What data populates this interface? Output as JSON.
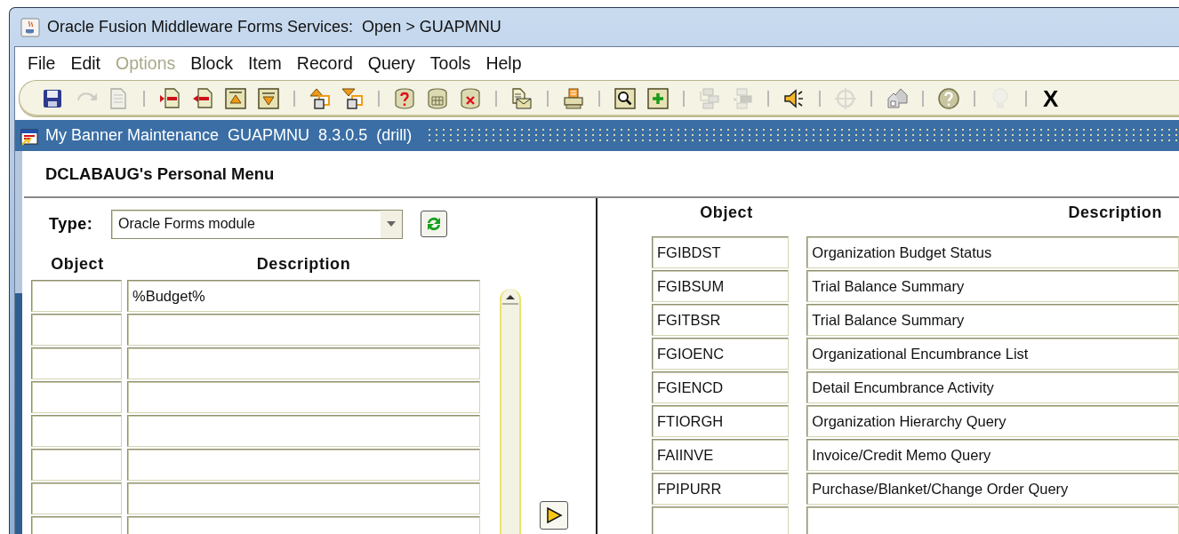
{
  "window": {
    "title": "Oracle Fusion Middleware Forms Services:  Open > GUAPMNU"
  },
  "menu": [
    {
      "label": "File",
      "disabled": false
    },
    {
      "label": "Edit",
      "disabled": false
    },
    {
      "label": "Options",
      "disabled": true
    },
    {
      "label": "Block",
      "disabled": false
    },
    {
      "label": "Item",
      "disabled": false
    },
    {
      "label": "Record",
      "disabled": false
    },
    {
      "label": "Query",
      "disabled": false
    },
    {
      "label": "Tools",
      "disabled": false
    },
    {
      "label": "Help",
      "disabled": false
    }
  ],
  "toolbar": {
    "groups": [
      [
        {
          "disabled": false
        },
        {
          "disabled": true
        },
        {
          "disabled": true
        }
      ],
      [
        {
          "disabled": false
        },
        {
          "disabled": false
        },
        {
          "disabled": false
        },
        {
          "disabled": false
        }
      ],
      [
        {
          "disabled": false
        },
        {
          "disabled": false
        }
      ],
      [
        {
          "disabled": false
        },
        {
          "disabled": false
        },
        {
          "disabled": false
        }
      ],
      [
        {
          "disabled": false
        }
      ],
      [
        {
          "disabled": false
        }
      ],
      [
        {
          "disabled": false
        },
        {
          "disabled": false
        }
      ],
      [
        {
          "disabled": true
        },
        {
          "disabled": true
        }
      ],
      [
        {
          "disabled": false
        }
      ],
      [
        {
          "disabled": true
        }
      ],
      [
        {
          "disabled": false
        }
      ],
      [
        {
          "disabled": false
        }
      ],
      [
        {
          "disabled": true
        }
      ]
    ],
    "exit_label": "X"
  },
  "form_bar": {
    "title": "My Banner Maintenance  GUAPMNU  8.3.0.5  (drill)"
  },
  "heading": "DCLABAUG's Personal Menu",
  "search": {
    "type_label": "Type:",
    "type_value": "Oracle Forms module",
    "columns": [
      "Object",
      "Description"
    ],
    "rows": [
      {
        "description": "%Budget%"
      }
    ]
  },
  "results": {
    "columns": [
      "Object",
      "Description"
    ],
    "rows": [
      {
        "object": "FGIBDST",
        "description": "Organization Budget Status"
      },
      {
        "object": "FGIBSUM",
        "description": "Trial Balance Summary"
      },
      {
        "object": "FGITBSR",
        "description": "Trial Balance Summary"
      },
      {
        "object": "FGIOENC",
        "description": "Organizational Encumbrance List"
      },
      {
        "object": "FGIENCD",
        "description": "Detail Encumbrance Activity"
      },
      {
        "object": "FTIORGH",
        "description": "Organization Hierarchy Query"
      },
      {
        "object": "FAIINVE",
        "description": "Invoice/Credit Memo Query"
      },
      {
        "object": "FPIPURR",
        "description": "Purchase/Blanket/Change Order Query"
      }
    ]
  }
}
